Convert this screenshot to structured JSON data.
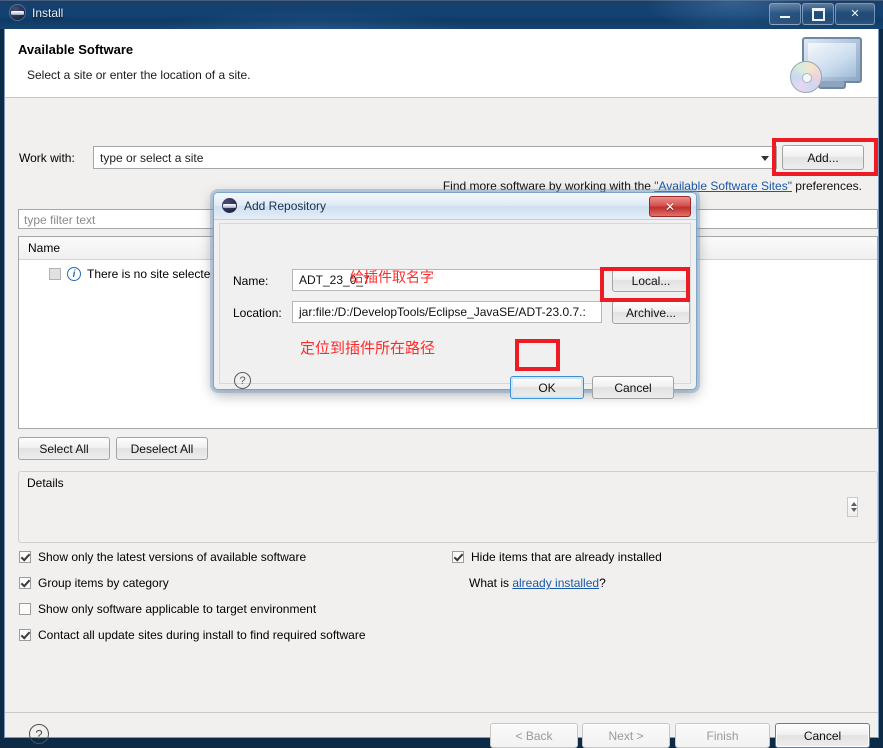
{
  "window": {
    "title": "Install",
    "icon": "eclipse-icon",
    "buttons": {
      "minimize": "minimize",
      "maximize": "maximize",
      "close": "✕"
    }
  },
  "header": {
    "title": "Available Software",
    "subtitle": "Select a site or enter the location of a site.",
    "icon": "monitor-disc-icon"
  },
  "workwith": {
    "label": "Work with:",
    "placeholder": "type or select a site",
    "add_button": "Add...",
    "hint_prefix": "Find more software by working with the ",
    "hint_link": "\"Available Software Sites\"",
    "hint_suffix": " preferences."
  },
  "filter": {
    "placeholder": "type filter text"
  },
  "list": {
    "column_name": "Name",
    "rows": [
      {
        "label": "There is no site selecte",
        "icon": "info-icon",
        "checked": false
      }
    ]
  },
  "actions": {
    "select_all": "Select All",
    "deselect_all": "Deselect All"
  },
  "details": {
    "label": "Details"
  },
  "options": {
    "left": [
      {
        "label": "Show only the latest versions of available software",
        "checked": true
      },
      {
        "label": "Group items by category",
        "checked": true
      },
      {
        "label": "Show only software applicable to target environment",
        "checked": false
      },
      {
        "label": "Contact all update sites during install to find required software",
        "checked": true
      }
    ],
    "right": [
      {
        "label": "Hide items that are already installed",
        "checked": true
      }
    ],
    "whatis_prefix": "What is ",
    "whatis_link": "already installed",
    "whatis_suffix": "?"
  },
  "footer": {
    "help": "?",
    "back": "< Back",
    "next": "Next >",
    "finish": "Finish",
    "cancel": "Cancel"
  },
  "dialog": {
    "title": "Add Repository",
    "icon": "eclipse-icon",
    "close": "✕",
    "name_label": "Name:",
    "name_value": "ADT_23_0_7",
    "location_label": "Location:",
    "location_value": "jar:file:/D:/DevelopTools/Eclipse_JavaSE/ADT-23.0.7.:",
    "local_button": "Local...",
    "archive_button": "Archive...",
    "ok_button": "OK",
    "cancel_button": "Cancel",
    "help": "?",
    "annotation_name": "给插件取名字",
    "annotation_path": "定位到插件所在路径"
  },
  "colors": {
    "annotation_red": "#ed1c24",
    "annotation_text_red": "#ff2b2b",
    "link_blue": "#1959a8",
    "titlebar_blue": "#124273"
  }
}
